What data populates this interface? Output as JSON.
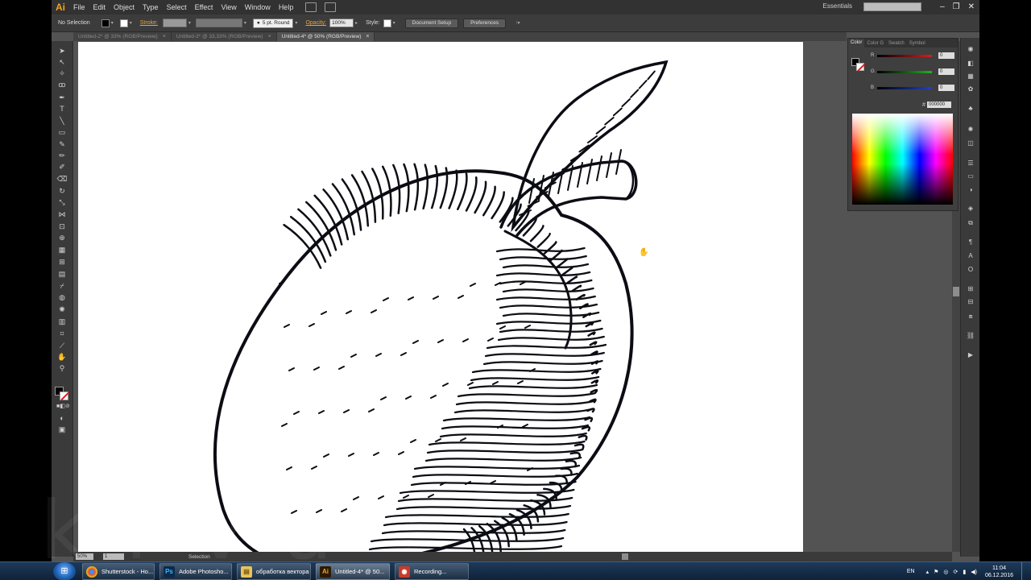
{
  "menu": {
    "logo": "Ai",
    "items": [
      "File",
      "Edit",
      "Object",
      "Type",
      "Select",
      "Effect",
      "View",
      "Window",
      "Help"
    ],
    "workspace": "Essentials",
    "win_min": "–",
    "win_max": "❐",
    "win_close": "✕"
  },
  "control_bar": {
    "selection": "No Selection",
    "stroke_label": "Stroke:",
    "brush": "5 pt. Round",
    "opacity_label": "Opacity:",
    "opacity_value": "100%",
    "style_label": "Style:",
    "document_setup": "Document Setup",
    "preferences": "Preferences"
  },
  "tabs": [
    {
      "label": "Untitled-2* @ 33% (RGB/Preview)",
      "close": "×"
    },
    {
      "label": "Untitled-3* @ 33,33% (RGB/Preview)",
      "close": "×"
    },
    {
      "label": "Untitled-4* @ 50% (RGB/Preview)",
      "close": "×"
    }
  ],
  "status": {
    "zoom": "50%",
    "page": "1",
    "tool": "Selection"
  },
  "color_panel": {
    "tabs": [
      "Color",
      "Color G",
      "Swatch",
      "Symbol"
    ],
    "channels": [
      {
        "name": "R",
        "value": "0",
        "color": "#d22020"
      },
      {
        "name": "G",
        "value": "0",
        "color": "#22b022"
      },
      {
        "name": "B",
        "value": "0",
        "color": "#2040d0"
      }
    ],
    "hex_label": "#",
    "hex": "000000"
  },
  "taskbar": {
    "start": "⊞",
    "items": [
      {
        "label": "Shutterstock - Ho...",
        "icon": "chrome",
        "badge": "●"
      },
      {
        "label": "Adobe Photosho...",
        "icon": "photoshop",
        "badge": "Ps"
      },
      {
        "label": "обработка вектора",
        "icon": "folder",
        "badge": "▤"
      },
      {
        "label": "Untitled-4* @ 50...",
        "icon": "illustrator",
        "badge": "Ai"
      },
      {
        "label": "Recording...",
        "icon": "recorder",
        "badge": "◉"
      }
    ],
    "lang": "EN",
    "time": "11:04",
    "date": "06.12.2016"
  },
  "colors": {
    "app_bg": "#535353",
    "accent_orange": "#f7a21b"
  }
}
